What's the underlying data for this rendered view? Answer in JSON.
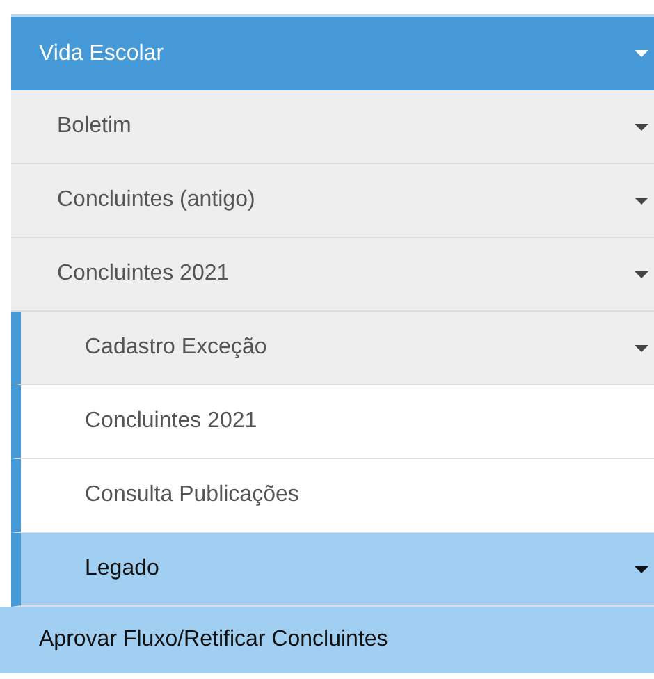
{
  "menu": {
    "label": "Vida Escolar",
    "expanded": true,
    "items": [
      {
        "label": "Boletim",
        "expanded": false
      },
      {
        "label": "Concluintes (antigo)",
        "expanded": false
      },
      {
        "label": "Concluintes 2021",
        "expanded": true,
        "children": [
          {
            "label": "Cadastro Exceção",
            "kind": "submenu",
            "selected": false
          },
          {
            "label": "Concluintes 2021",
            "kind": "link",
            "selected": false
          },
          {
            "label": "Consulta Publicações",
            "kind": "link",
            "selected": false
          },
          {
            "label": "Legado",
            "kind": "submenu",
            "selected": true
          }
        ]
      }
    ]
  },
  "next_item": {
    "label": "Aprovar Fluxo/Retificar Concluintes",
    "selected": true
  }
}
